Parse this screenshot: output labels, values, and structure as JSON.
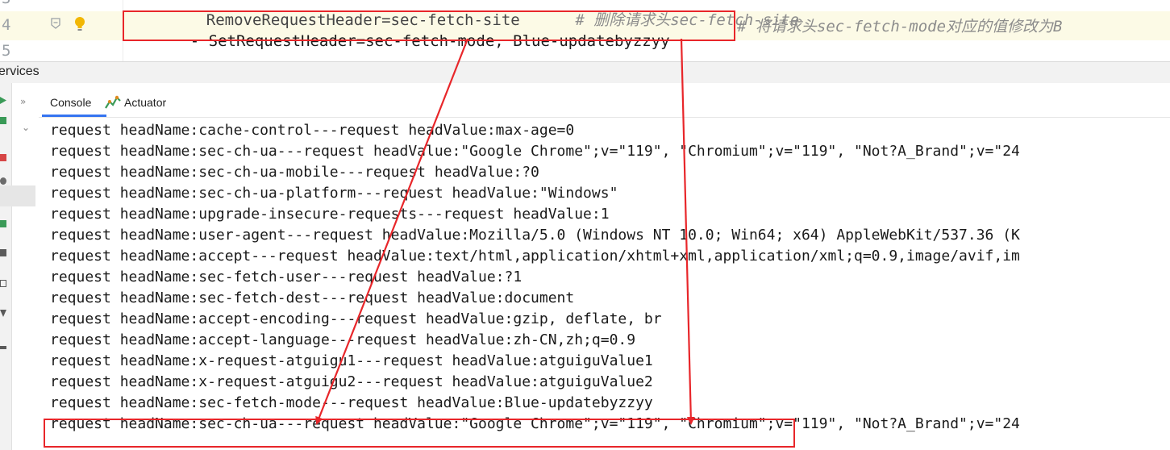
{
  "editor": {
    "line_numbers": [
      "3",
      "4",
      "5"
    ],
    "prev_line_code": "RemoveRequestHeader=sec-fetch-site",
    "prev_line_comment": "# 删除请求头sec-fetch-site",
    "current_line_code": "- SetRequestHeader=sec-fetch-mode, Blue-updatebyzzyy",
    "current_line_comment": "# 将请求头sec-fetch-mode对应的值修改为B"
  },
  "services": {
    "title": "ervices"
  },
  "tabs": [
    {
      "label": "Console",
      "active": true
    },
    {
      "label": "Actuator",
      "active": false
    }
  ],
  "console": {
    "lines": [
      "request headName:cache-control---request headValue:max-age=0",
      "request headName:sec-ch-ua---request headValue:\"Google Chrome\";v=\"119\", \"Chromium\";v=\"119\", \"Not?A_Brand\";v=\"24",
      "request headName:sec-ch-ua-mobile---request headValue:?0",
      "request headName:sec-ch-ua-platform---request headValue:\"Windows\"",
      "request headName:upgrade-insecure-requests---request headValue:1",
      "request headName:user-agent---request headValue:Mozilla/5.0 (Windows NT 10.0; Win64; x64) AppleWebKit/537.36 (K",
      "request headName:accept---request headValue:text/html,application/xhtml+xml,application/xml;q=0.9,image/avif,im",
      "request headName:sec-fetch-user---request headValue:?1",
      "request headName:sec-fetch-dest---request headValue:document",
      "request headName:accept-encoding---request headValue:gzip, deflate, br",
      "request headName:accept-language---request headValue:zh-CN,zh;q=0.9",
      "request headName:x-request-atguigu1---request headValue:atguiguValue1",
      "request headName:x-request-atguigu2---request headValue:atguiguValue2",
      "request headName:sec-fetch-mode---request headValue:Blue-updatebyzzyy",
      "request headName:sec-ch-ua---request headValue:\"Google Chrome\";v=\"119\", \"Chromium\";v=\"119\", \"Not?A_Brand\";v=\"24"
    ]
  },
  "colors": {
    "annotation": "#e8262a",
    "tab_underline": "#3574f0",
    "current_line": "#fcfae6"
  },
  "icons": [
    "fold-icon",
    "lightbulb-icon",
    "actuator-icon",
    "chevron-right-icon",
    "chevron-down-icon"
  ]
}
